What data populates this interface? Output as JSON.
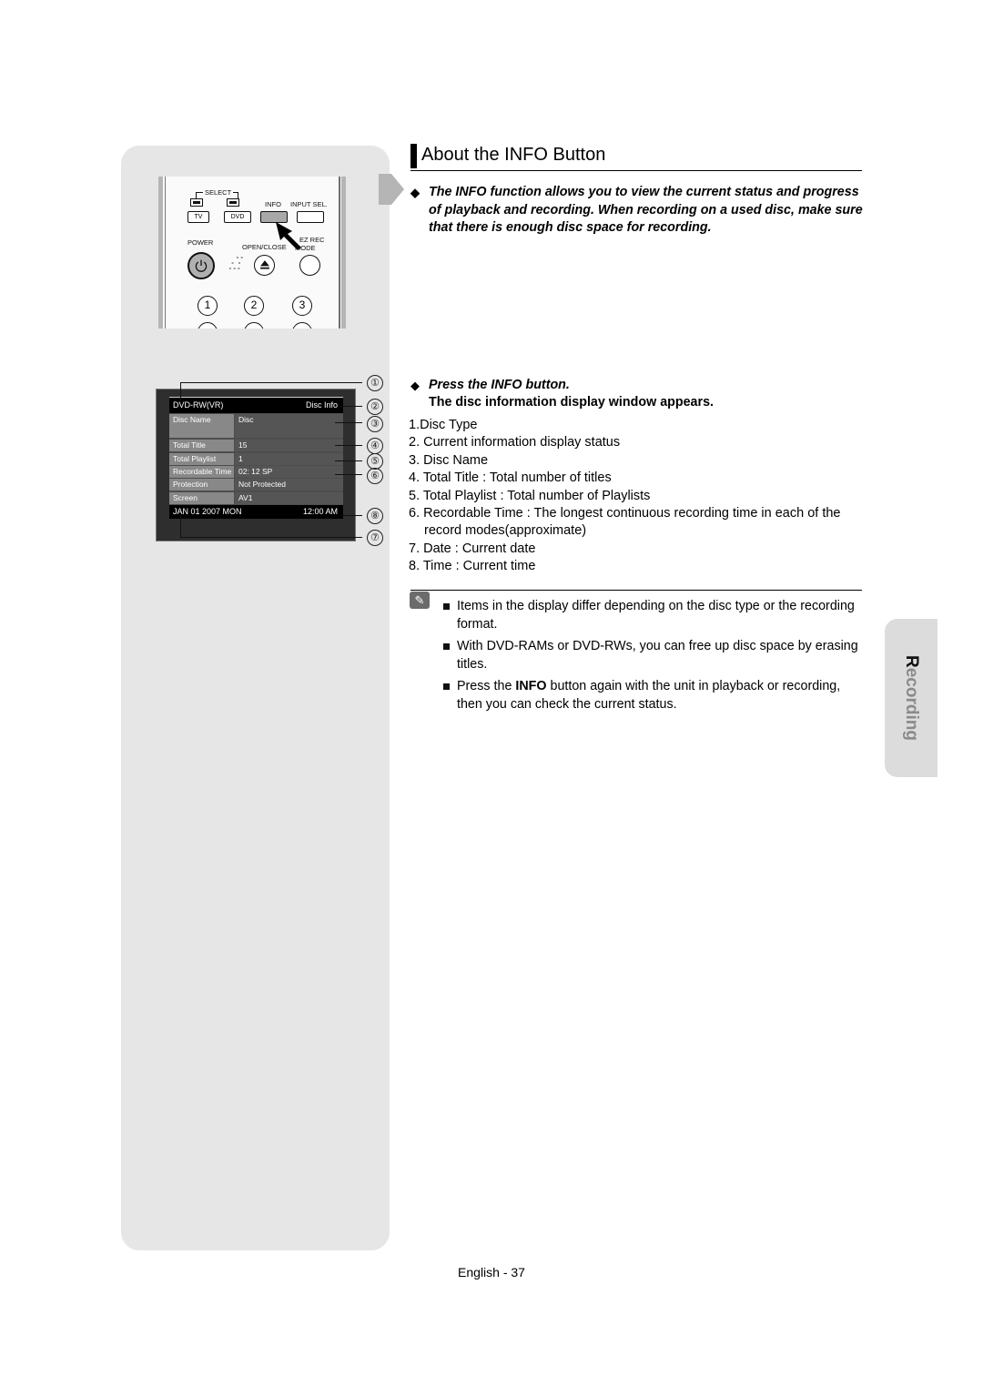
{
  "page": {
    "section_tab": "Recording",
    "footer": "English - 37"
  },
  "header": {
    "title": "About the INFO Button"
  },
  "intro": {
    "text": "The INFO function allows you to view the current status and progress of playback and recording. When recording on a used disc, make sure that there is enough disc space for recording."
  },
  "remote": {
    "select_label": "SELECT",
    "info_label": "INFO",
    "input_sel_label": "INPUT SEL.",
    "tv_label": "TV",
    "dvd_label": "DVD",
    "power_label": "POWER",
    "open_close_label": "OPEN/CLOSE",
    "ez_rec_label": "EZ REC",
    "mode_label": "MODE",
    "digits": [
      "1",
      "2",
      "3"
    ]
  },
  "info_screen": {
    "disc_type": "DVD-RW(VR)",
    "status": "Disc Info",
    "rows": [
      {
        "key": "Disc Name",
        "value": "Disc"
      },
      {
        "key": "Total Title",
        "value": "15"
      },
      {
        "key": "Total Playlist",
        "value": "1"
      },
      {
        "key": "Recordable Time",
        "value": "02: 12 SP"
      },
      {
        "key": "Protection",
        "value": "Not Protected"
      },
      {
        "key": "Screen",
        "value": "AV1"
      }
    ],
    "date": "JAN 01 2007 MON",
    "time": "12:00 AM",
    "callouts": [
      "①",
      "②",
      "③",
      "④",
      "⑤",
      "⑥",
      "⑧",
      "⑦"
    ]
  },
  "step": {
    "title": "Press the INFO button.",
    "result": "The disc information display window appears."
  },
  "items": [
    "1.Disc Type",
    "2. Current information display status",
    "3. Disc Name",
    "4. Total Title : Total number of titles",
    "5. Total Playlist : Total number of Playlists",
    "6. Recordable Time : The longest continuous recording time in each of the record modes(approximate)",
    "7. Date : Current date",
    "8. Time : Current time"
  ],
  "notes": {
    "icon": "note-pencil-icon",
    "list": [
      {
        "before": "Items in the display differ depending on the disc type or the recording format.",
        "bold": "",
        "after": ""
      },
      {
        "before": "With DVD-RAMs or DVD-RWs, you can free up disc space by erasing titles.",
        "bold": "",
        "after": ""
      },
      {
        "before": "Press the ",
        "bold": "INFO",
        "after": " button again with the unit in playback or recording, then you can check the current status."
      }
    ]
  }
}
